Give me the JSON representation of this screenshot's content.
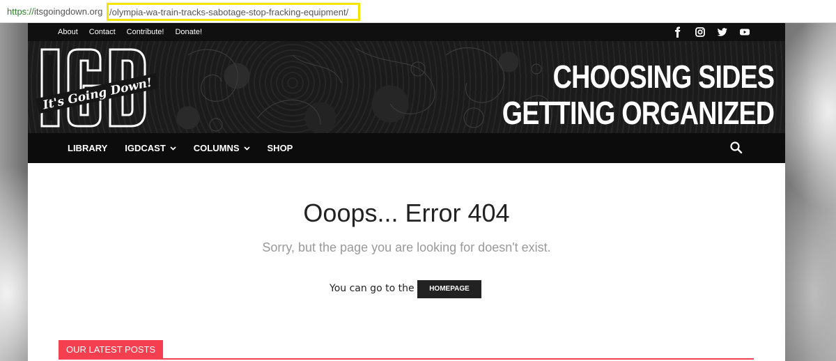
{
  "browser": {
    "url_scheme": "https://",
    "url_host": "itsgoingdown.org",
    "url_path": "/olympia-wa-train-tracks-sabotage-stop-fracking-equipment/"
  },
  "topbar": {
    "links": [
      "About",
      "Contact",
      "Contribute!",
      "Donate!"
    ],
    "socials": [
      "facebook-icon",
      "instagram-icon",
      "twitter-icon",
      "youtube-icon"
    ]
  },
  "banner": {
    "logo_letters": "IGD",
    "logo_script": "It's Going Down!",
    "tagline_line1": "CHOOSING SIDES",
    "tagline_line2": "GETTING ORGANIZED"
  },
  "menu": {
    "items": [
      {
        "label": "LIBRARY",
        "has_dropdown": false
      },
      {
        "label": "IGDCAST",
        "has_dropdown": true
      },
      {
        "label": "COLUMNS",
        "has_dropdown": true
      },
      {
        "label": "SHOP",
        "has_dropdown": false
      }
    ]
  },
  "error": {
    "title": "Ooops... Error 404",
    "subtitle": "Sorry, but the page you are looking for doesn't exist.",
    "goto_text": "You can go to the",
    "home_button": "HOMEPAGE"
  },
  "latest": {
    "label": "OUR LATEST POSTS"
  },
  "colors": {
    "accent": "#f43f50",
    "highlight": "#f2e600"
  }
}
